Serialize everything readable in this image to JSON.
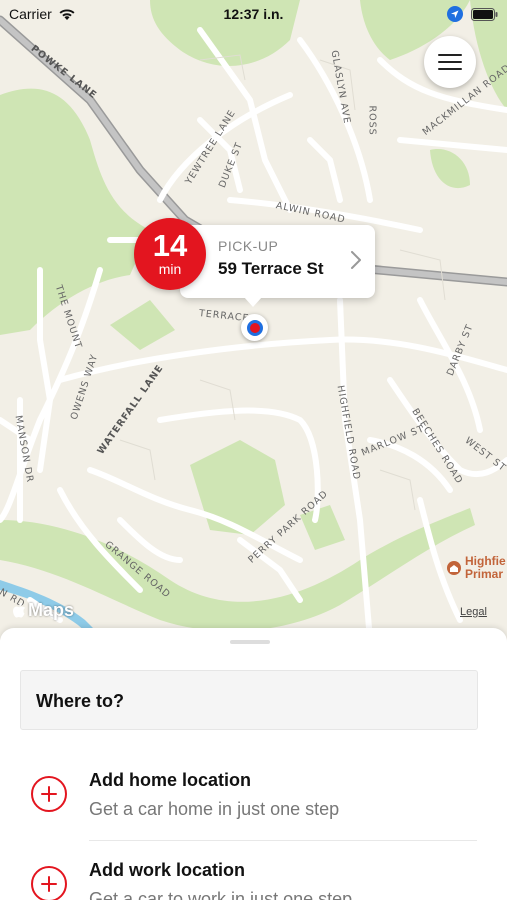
{
  "status": {
    "carrier": "Carrier",
    "time": "12:37 i.n."
  },
  "map": {
    "streets": {
      "powke": "POWKE LANE",
      "yewtree": "YEWTREE LANE",
      "duke": "DUKE ST",
      "glaslyn": "GLASLYN AVE",
      "ross": "ROSS",
      "mackmillan": "MACKMILLAN ROAD",
      "alwin": "ALWIN ROAD",
      "mount": "THE MOUNT",
      "terrace": "TERRACE",
      "owens": "OWENS WAY",
      "waterfall": "WATERFALL LANE",
      "manson": "MANSON DR",
      "highfield": "HIGHFIELD ROAD",
      "marlow": "MARLOW ST",
      "beeches": "BEECHES ROAD",
      "darby": "DARBY ST",
      "west": "WEST ST",
      "grange": "GRANGE ROAD",
      "perrypark": "PERRY PARK ROAD",
      "ndr": "N RD"
    },
    "poi": [
      "Highfie",
      "Primar"
    ],
    "maps_logo": "Maps",
    "legal": "Legal"
  },
  "pickup": {
    "eta_minutes": "14",
    "eta_unit": "min",
    "label": "PICK-UP",
    "address": "59 Terrace St"
  },
  "sheet": {
    "search_placeholder": "Where to?",
    "items": [
      {
        "title": "Add home location",
        "subtitle": "Get a car home in just one step"
      },
      {
        "title": "Add work location",
        "subtitle": "Get a car to work in just one step"
      }
    ]
  },
  "colors": {
    "accent": "#e3151f",
    "map_bg": "#f2efe6",
    "park": "#cfe5b4",
    "location_ring": "#1f6fe0"
  }
}
